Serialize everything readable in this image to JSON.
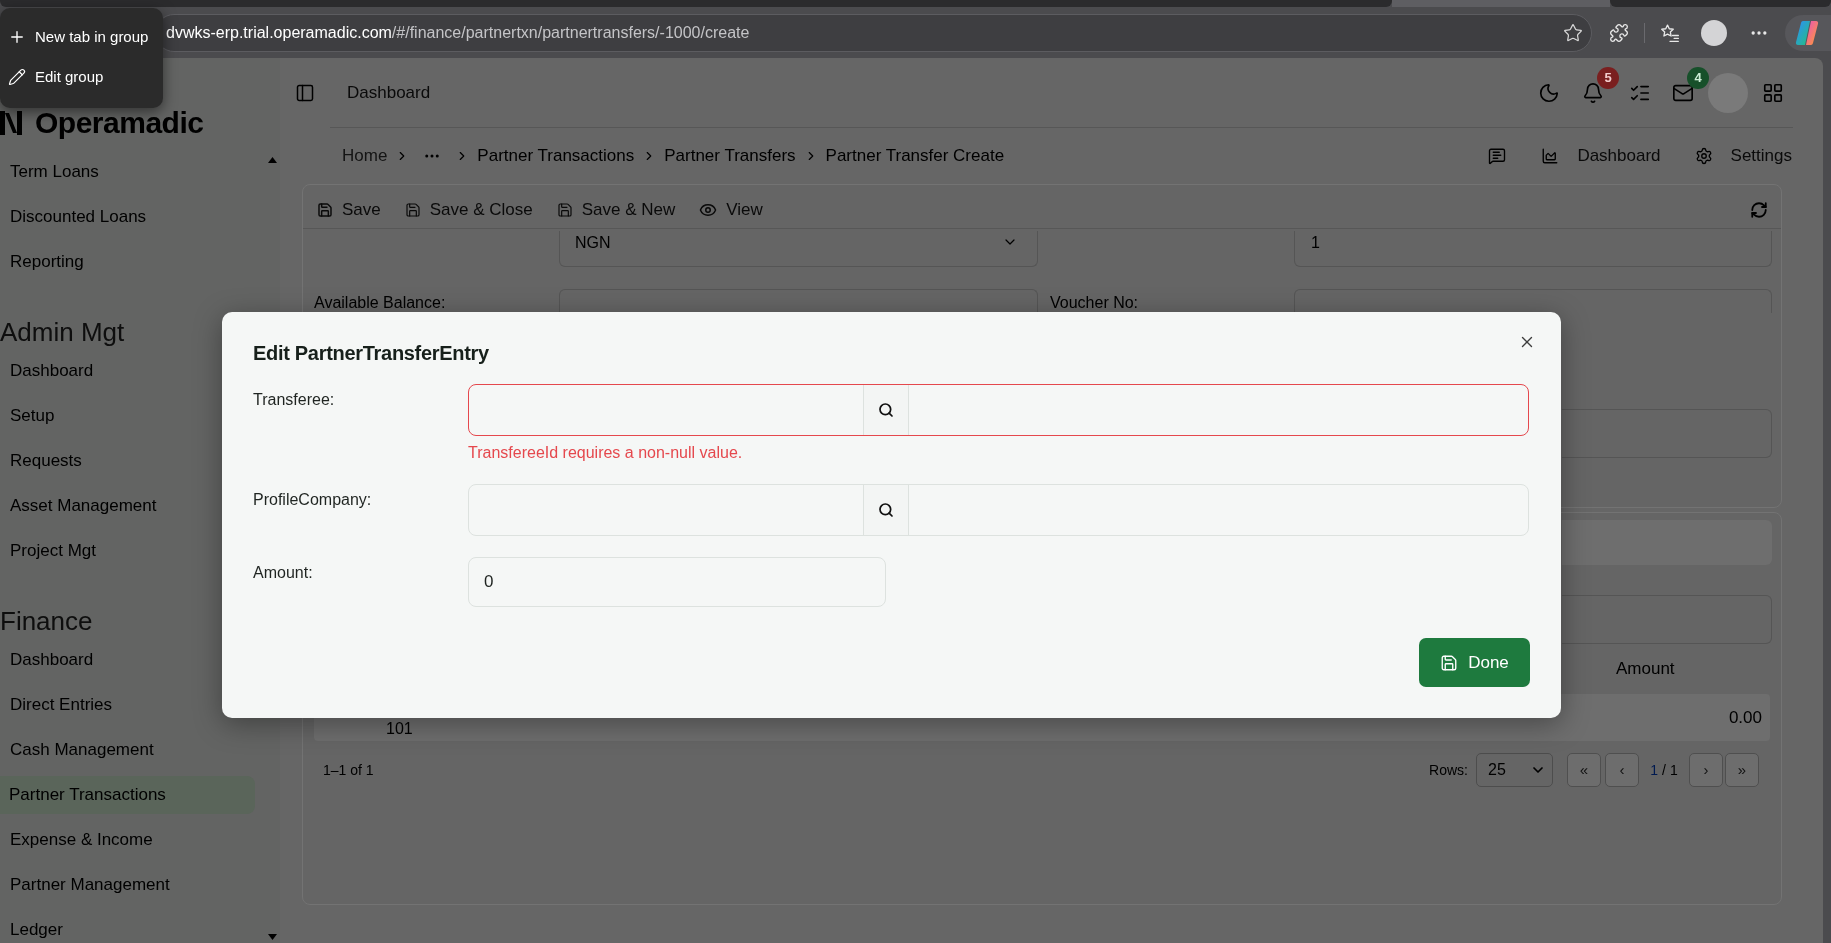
{
  "browser": {
    "tabs": [
      {
        "selected": false
      },
      {
        "selected": true
      },
      {
        "selected": false
      }
    ],
    "address_bar": {
      "host": "dvwks-erp.trial.operamadic.com",
      "path": "/#/finance/partnertxn/partnertransfers/-1000/create"
    },
    "tab_group_menu": [
      {
        "kind": "add",
        "label": "New tab in group"
      },
      {
        "kind": "edit",
        "label": "Edit group"
      }
    ]
  },
  "sidebar": {
    "logo": "Operamadic",
    "sections": [
      {
        "items": [
          {
            "label": "Term Loans",
            "selected": false
          },
          {
            "label": "Discounted Loans",
            "selected": false
          },
          {
            "label": "Reporting",
            "selected": false
          }
        ]
      },
      {
        "title": "Admin Mgt",
        "items": [
          {
            "label": "Dashboard",
            "selected": false
          },
          {
            "label": "Setup",
            "selected": false
          },
          {
            "label": "Requests",
            "selected": false
          },
          {
            "label": "Asset Management",
            "selected": false
          },
          {
            "label": "Project Mgt",
            "selected": false
          }
        ]
      },
      {
        "title": "Finance",
        "items": [
          {
            "label": "Dashboard",
            "selected": false
          },
          {
            "label": "Direct Entries",
            "selected": false
          },
          {
            "label": "Cash Management",
            "selected": false
          },
          {
            "label": "Partner Transactions",
            "selected": true
          },
          {
            "label": "Expense & Income",
            "selected": false
          },
          {
            "label": "Partner Management",
            "selected": false
          },
          {
            "label": "Ledger",
            "selected": false
          }
        ]
      }
    ]
  },
  "header": {
    "title": "Dashboard",
    "notifications_count": "5",
    "messages_count": "4"
  },
  "breadcrumbs": [
    {
      "kind": "home",
      "label": "Home"
    },
    {
      "kind": "more"
    },
    {
      "kind": "link",
      "label": "Partner Transactions"
    },
    {
      "kind": "link",
      "label": "Partner Transfers"
    },
    {
      "kind": "link",
      "label": "Partner Transfer Create"
    }
  ],
  "page_actions": [
    {
      "kind": "comments"
    },
    {
      "kind": "dashboard",
      "label": "Dashboard"
    },
    {
      "kind": "settings",
      "label": "Settings"
    }
  ],
  "toolbar": [
    {
      "kind": "save",
      "label": "Save"
    },
    {
      "kind": "save_close",
      "label": "Save & Close"
    },
    {
      "kind": "save_new",
      "label": "Save & New"
    },
    {
      "kind": "view",
      "label": "View"
    }
  ],
  "form": {
    "currency": "NGN",
    "field_value": "1",
    "balance_label": "Available Balance:",
    "voucher_label": "Voucher No:"
  },
  "table": {
    "columns": [
      "Amount"
    ],
    "rows": [
      {
        "column_1": "101",
        "amount": "0.00"
      }
    ]
  },
  "pagination": {
    "summary": "1–1 of 1",
    "rows_label": "Rows:",
    "rows_per_page": "25",
    "first": "«",
    "previous": "‹",
    "page": "1",
    "of": "/ 1",
    "next": "›",
    "last": "»"
  },
  "dialog": {
    "title": "Edit PartnerTransferEntry",
    "fields": [
      {
        "kind": "lookup",
        "label": "Transferee:",
        "invalid": true,
        "error": "TransfereeId requires a non-null value."
      },
      {
        "kind": "lookup",
        "label": "ProfileCompany:",
        "invalid": false
      },
      {
        "kind": "number",
        "label": "Amount:",
        "value": "0"
      }
    ],
    "done": "Done"
  }
}
